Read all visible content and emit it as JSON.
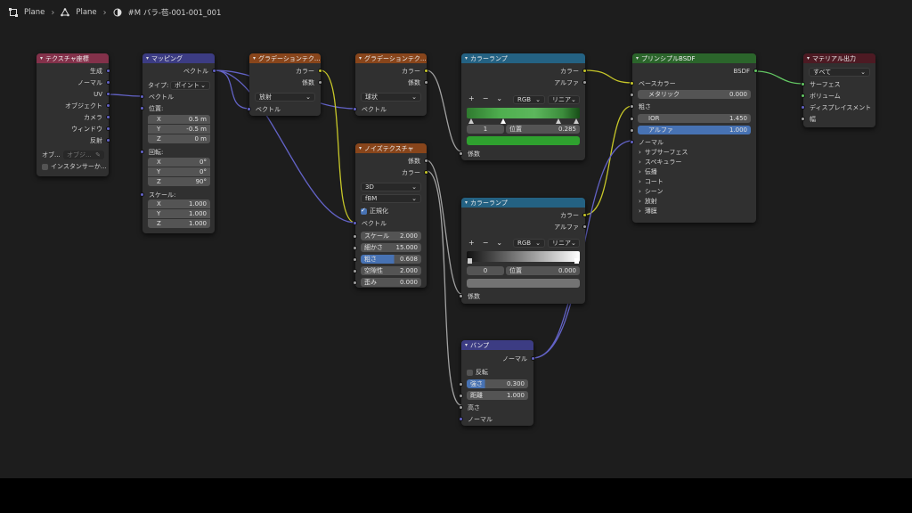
{
  "breadcrumb": {
    "object": "Plane",
    "mesh": "Plane",
    "material": "#M バラ-苞-001-001_001"
  },
  "nodes": {
    "texcoord": {
      "title": "テクスチャ座標",
      "outputs": [
        "生成",
        "ノーマル",
        "UV",
        "オブジェクト",
        "カメラ",
        "ウィンドウ",
        "反射"
      ],
      "object_label": "オブ...",
      "object_field": "オブジ...",
      "instancer": "インスタンサーか..."
    },
    "mapping": {
      "title": "マッピング",
      "out_vector": "ベクトル",
      "type_label": "タイプ:",
      "type_value": "ポイント",
      "in_vector": "ベクトル",
      "location": "位置:",
      "loc": [
        [
          "X",
          "0.5 m"
        ],
        [
          "Y",
          "-0.5 m"
        ],
        [
          "Z",
          "0 m"
        ]
      ],
      "rotation": "回転:",
      "rot": [
        [
          "X",
          "0°"
        ],
        [
          "Y",
          "0°"
        ],
        [
          "Z",
          "90°"
        ]
      ],
      "scale": "スケール:",
      "scl": [
        [
          "X",
          "1.000"
        ],
        [
          "Y",
          "1.000"
        ],
        [
          "Z",
          "1.000"
        ]
      ]
    },
    "grad1": {
      "title": "グラデーションテク...",
      "out_color": "カラー",
      "out_fac": "係数",
      "type": "放射",
      "in_vector": "ベクトル"
    },
    "grad2": {
      "title": "グラデーションテク...",
      "out_color": "カラー",
      "out_fac": "係数",
      "type": "球状",
      "in_vector": "ベクトル"
    },
    "noise": {
      "title": "ノイズテクスチャ",
      "out_fac": "係数",
      "out_color": "カラー",
      "dims": "3D",
      "type": "fBM",
      "normalize": "正規化",
      "in_vector": "ベクトル",
      "params": [
        [
          "スケール",
          "2.000"
        ],
        [
          "細かさ",
          "15.000"
        ],
        [
          "粗さ",
          "0.608"
        ],
        [
          "空隙性",
          "2.000"
        ],
        [
          "歪み",
          "0.000"
        ]
      ]
    },
    "ramp1": {
      "title": "カラーランプ",
      "out_color": "カラー",
      "out_alpha": "アルファ",
      "mode": "RGB",
      "interp": "リニア",
      "index": "1",
      "pos_label": "位置",
      "pos": "0.285",
      "in_fac": "係数",
      "swatch": "#2fa12f"
    },
    "ramp2": {
      "title": "カラーランプ",
      "out_color": "カラー",
      "out_alpha": "アルファ",
      "mode": "RGB",
      "interp": "リニア",
      "index": "0",
      "pos_label": "位置",
      "pos": "0.000",
      "in_fac": "係数",
      "swatch": "#737373"
    },
    "bump": {
      "title": "バンプ",
      "out_normal": "ノーマル",
      "invert": "反転",
      "strength_label": "強さ",
      "strength": "0.300",
      "distance_label": "距離",
      "distance": "1.000",
      "in_height": "高さ",
      "in_normal": "ノーマル"
    },
    "bsdf": {
      "title": "プリンシプルBSDF",
      "out": "BSDF",
      "base_color": "ベースカラー",
      "metallic_label": "メタリック",
      "metallic": "0.000",
      "roughness": "粗さ",
      "ior_label": "IOR",
      "ior": "1.450",
      "alpha_label": "アルファ",
      "alpha": "1.000",
      "normal": "ノーマル",
      "panels": [
        "サブサーフェス",
        "スペキュラー",
        "伝播",
        "コート",
        "シーン",
        "放射",
        "薄膜"
      ]
    },
    "output": {
      "title": "マテリアル出力",
      "target": "すべて",
      "inputs": [
        "サーフェス",
        "ボリューム",
        "ディスプレイスメント",
        "幅"
      ]
    }
  },
  "colors": {
    "texcoord_header": "#83314a",
    "mapping_header": "#3c3c83",
    "texture_header": "#88451b",
    "converter_header": "#246283",
    "shader_header": "#2b652b",
    "output_header": "#4d1a23",
    "vector_header": "#3c3c83"
  }
}
